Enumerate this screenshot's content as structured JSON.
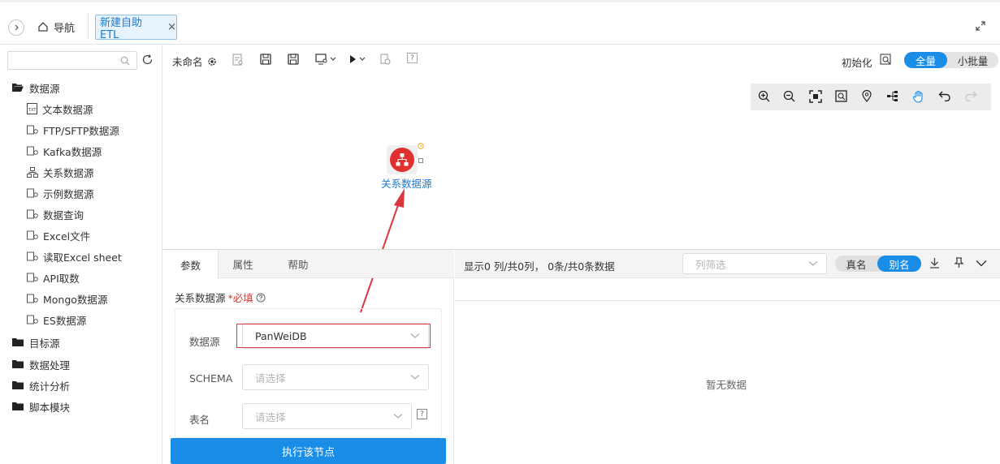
{
  "header": {
    "nav_label": "导航",
    "active_tab_label": "新建自助ETL",
    "tab_close": "×"
  },
  "sidebar": {
    "search_placeholder": "",
    "folders": [
      {
        "label": "数据源",
        "open": true,
        "items": [
          {
            "label": "文本数据源",
            "icon": "text-file-icon"
          },
          {
            "label": "FTP/SFTP数据源",
            "icon": "datasource-icon"
          },
          {
            "label": "Kafka数据源",
            "icon": "datasource-icon"
          },
          {
            "label": "关系数据源",
            "icon": "relation-icon"
          },
          {
            "label": "示例数据源",
            "icon": "datasource-icon"
          },
          {
            "label": "数据查询",
            "icon": "datasource-icon"
          },
          {
            "label": "Excel文件",
            "icon": "datasource-icon"
          },
          {
            "label": "读取Excel sheet",
            "icon": "datasource-icon"
          },
          {
            "label": "API取数",
            "icon": "datasource-icon"
          },
          {
            "label": "Mongo数据源",
            "icon": "datasource-icon"
          },
          {
            "label": "ES数据源",
            "icon": "datasource-icon"
          }
        ]
      },
      {
        "label": "目标源",
        "open": false
      },
      {
        "label": "数据处理",
        "open": false
      },
      {
        "label": "统计分析",
        "open": false
      },
      {
        "label": "脚本模块",
        "open": false
      }
    ]
  },
  "toolbar": {
    "flow_name": "未命名",
    "init_label": "初始化",
    "mode_full": "全量",
    "mode_batch": "小批量",
    "help_mark": "?"
  },
  "canvas": {
    "node_label": "关系数据源",
    "node_color": "#e0302f",
    "annotation_color": "#d9363e"
  },
  "params": {
    "tabs": [
      "参数",
      "属性",
      "帮助"
    ],
    "section_title": "关系数据源",
    "required_label": "*必填",
    "fields": [
      {
        "label": "数据源",
        "value": "PanWeiDB",
        "placeholder": ""
      },
      {
        "label": "SCHEMA",
        "value": "",
        "placeholder": "请选择"
      },
      {
        "label": "表名",
        "value": "",
        "placeholder": "请选择"
      }
    ],
    "table_help": "?",
    "execute_label": "执行该节点"
  },
  "data_panel": {
    "summary": "显示0 列/共0列，  0条/共0条数据",
    "column_filter_placeholder": "列筛选",
    "name_real": "真名",
    "name_alias": "别名",
    "empty_text": "暂无数据"
  },
  "colors": {
    "accent": "#1a8ee6",
    "tab_active_bg": "#e6f2fc",
    "link": "#1a7bd5"
  }
}
